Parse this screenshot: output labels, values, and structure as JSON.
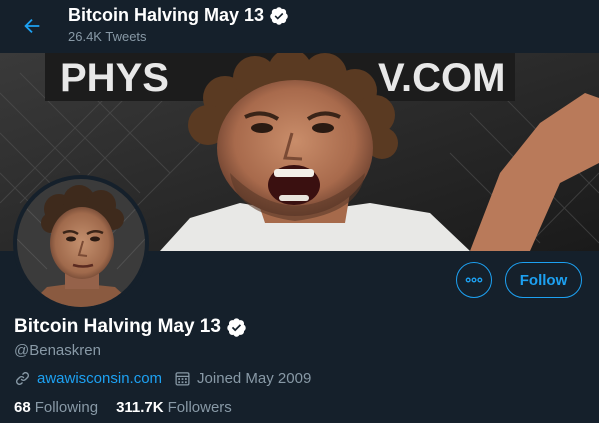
{
  "header": {
    "title": "Bitcoin Halving May 13",
    "tweet_count": "26.4K Tweets",
    "back_icon": "arrow-left-icon"
  },
  "banner": {
    "sign_text": "PHYS",
    "sign_text_right": "V.COM"
  },
  "profile": {
    "display_name": "Bitcoin Halving May 13",
    "handle": "@Benaskren",
    "verified": true,
    "website": "awawisconsin.com",
    "joined": "Joined May 2009",
    "following_count": "68",
    "following_label": "Following",
    "followers_count": "311.7K",
    "followers_label": "Followers"
  },
  "actions": {
    "more_label": "More",
    "follow_label": "Follow"
  },
  "colors": {
    "background": "#15202b",
    "accent": "#1da1f2",
    "secondary_text": "#8899a6",
    "primary_text": "#ffffff"
  }
}
